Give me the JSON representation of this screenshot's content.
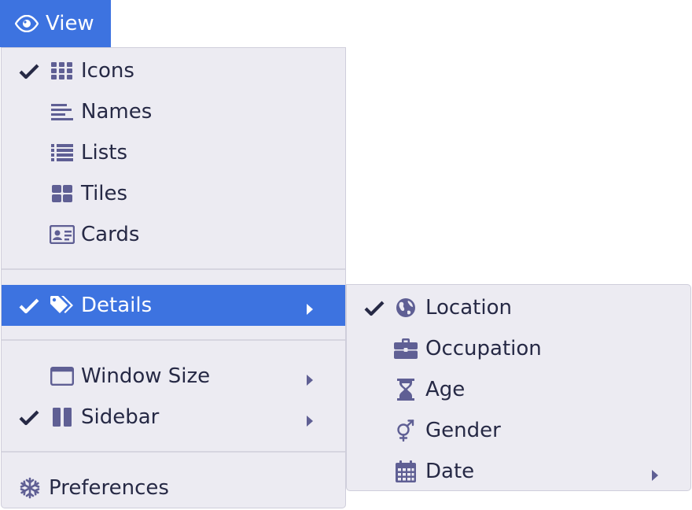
{
  "menu_button": {
    "label": "View",
    "icon": "eye-icon"
  },
  "menu": {
    "items": [
      {
        "label": "Icons",
        "icon": "grid-icon",
        "checked": true
      },
      {
        "label": "Names",
        "icon": "align-left-icon",
        "checked": false
      },
      {
        "label": "Lists",
        "icon": "list-icon",
        "checked": false
      },
      {
        "label": "Tiles",
        "icon": "tiles-icon",
        "checked": false
      },
      {
        "label": "Cards",
        "icon": "id-card-icon",
        "checked": false
      },
      {
        "label": "Details",
        "icon": "tags-icon",
        "checked": true,
        "active": true,
        "has_submenu": true
      },
      {
        "label": "Window Size",
        "icon": "window-icon",
        "checked": false,
        "has_submenu": true
      },
      {
        "label": "Sidebar",
        "icon": "columns-icon",
        "checked": true,
        "has_submenu": true
      },
      {
        "label": "Preferences",
        "icon": "snowflake-icon",
        "checked": false
      }
    ]
  },
  "submenu": {
    "items": [
      {
        "label": "Location",
        "icon": "globe-icon",
        "checked": true
      },
      {
        "label": "Occupation",
        "icon": "briefcase-icon",
        "checked": false
      },
      {
        "label": "Age",
        "icon": "hourglass-icon",
        "checked": false
      },
      {
        "label": "Gender",
        "icon": "gender-icon",
        "checked": false
      },
      {
        "label": "Date",
        "icon": "calendar-icon",
        "checked": false,
        "has_submenu": true
      }
    ]
  },
  "colors": {
    "accent": "#3d73e0",
    "panel_bg": "#ecebf2",
    "icon": "#5f5f94",
    "text": "#262945"
  }
}
